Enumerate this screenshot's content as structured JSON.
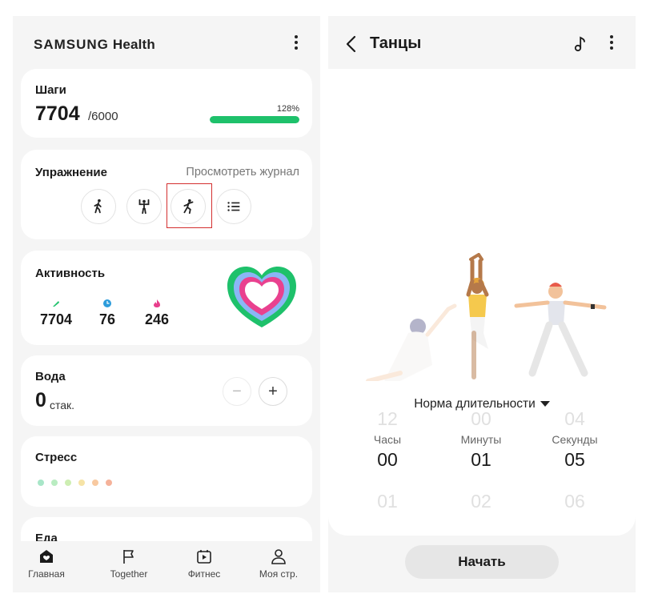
{
  "left": {
    "brand": {
      "samsung": "SAMSUNG",
      "health": "Health"
    },
    "steps": {
      "title": "Шаги",
      "value": "7704",
      "goal": "/6000",
      "percent_label": "128%",
      "progress_fraction": 1.0
    },
    "exercise": {
      "title": "Упражнение",
      "view_log": "Просмотреть журнал",
      "buttons": [
        "walking-icon",
        "strength-icon",
        "dance-icon",
        "list-icon"
      ]
    },
    "activity": {
      "title": "Активность",
      "stats": [
        {
          "icon": "steps-icon",
          "value": "7704",
          "color": "#1ec16b"
        },
        {
          "icon": "clock-icon",
          "value": "76",
          "color": "#2d9cdb"
        },
        {
          "icon": "flame-icon",
          "value": "246",
          "color": "#e83e8c"
        }
      ]
    },
    "water": {
      "title": "Вода",
      "value": "0",
      "unit": "стак.",
      "minus": "−",
      "plus": "+"
    },
    "stress": {
      "title": "Стресс",
      "dot_colors": [
        "#a8e6c8",
        "#b9ecc1",
        "#cdeeb2",
        "#f6e3a6",
        "#f8c9a0",
        "#f5b29a"
      ]
    },
    "food": {
      "title": "Еда"
    },
    "nav": [
      {
        "label": "Главная",
        "icon": "home-icon"
      },
      {
        "label": "Together",
        "icon": "flag-icon"
      },
      {
        "label": "Фитнес",
        "icon": "fitness-video-icon"
      },
      {
        "label": "Моя стр.",
        "icon": "profile-icon"
      }
    ]
  },
  "right": {
    "title": "Танцы",
    "norm_label": "Норма длительности",
    "picker": {
      "columns": [
        {
          "label": "Часы",
          "above": "12",
          "selected": "00",
          "below": "01"
        },
        {
          "label": "Минуты",
          "above": "00",
          "selected": "01",
          "below": "02"
        },
        {
          "label": "Секунды",
          "above": "04",
          "selected": "05",
          "below": "06"
        }
      ]
    },
    "start_label": "Начать"
  },
  "colors": {
    "accent_green": "#1ec16b",
    "highlight_red": "#d32f2f"
  }
}
